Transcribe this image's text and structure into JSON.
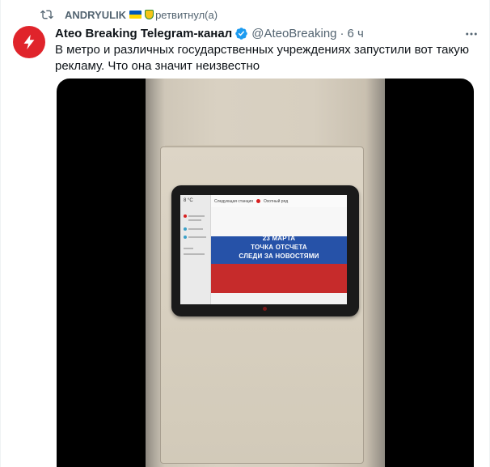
{
  "retweet": {
    "icon": "retweet-icon",
    "user": "ANDRYULIK",
    "label": "ретвитнул(а)"
  },
  "tweet": {
    "author_name": "Ateo Breaking Telegram-канал",
    "handle": "@AteoBreaking",
    "separator": "·",
    "time": "6 ч",
    "text": "В метро и различных государственных учреждениях запустили вот такую рекламу. Что она значит неизвестно"
  },
  "media": {
    "screen": {
      "temperature": "8 °C",
      "topbar_left": "Следующая станция",
      "topbar_right": "Охотный ряд",
      "banner_line1": "23 МАРТА",
      "banner_line2": "ТОЧКА ОТСЧЕТА",
      "banner_line3": "СЛЕДИ ЗА НОВОСТЯМИ"
    }
  },
  "colors": {
    "accent": "#1d9bf0",
    "avatar_bg": "#e0242b",
    "secondary_text": "#536471"
  }
}
